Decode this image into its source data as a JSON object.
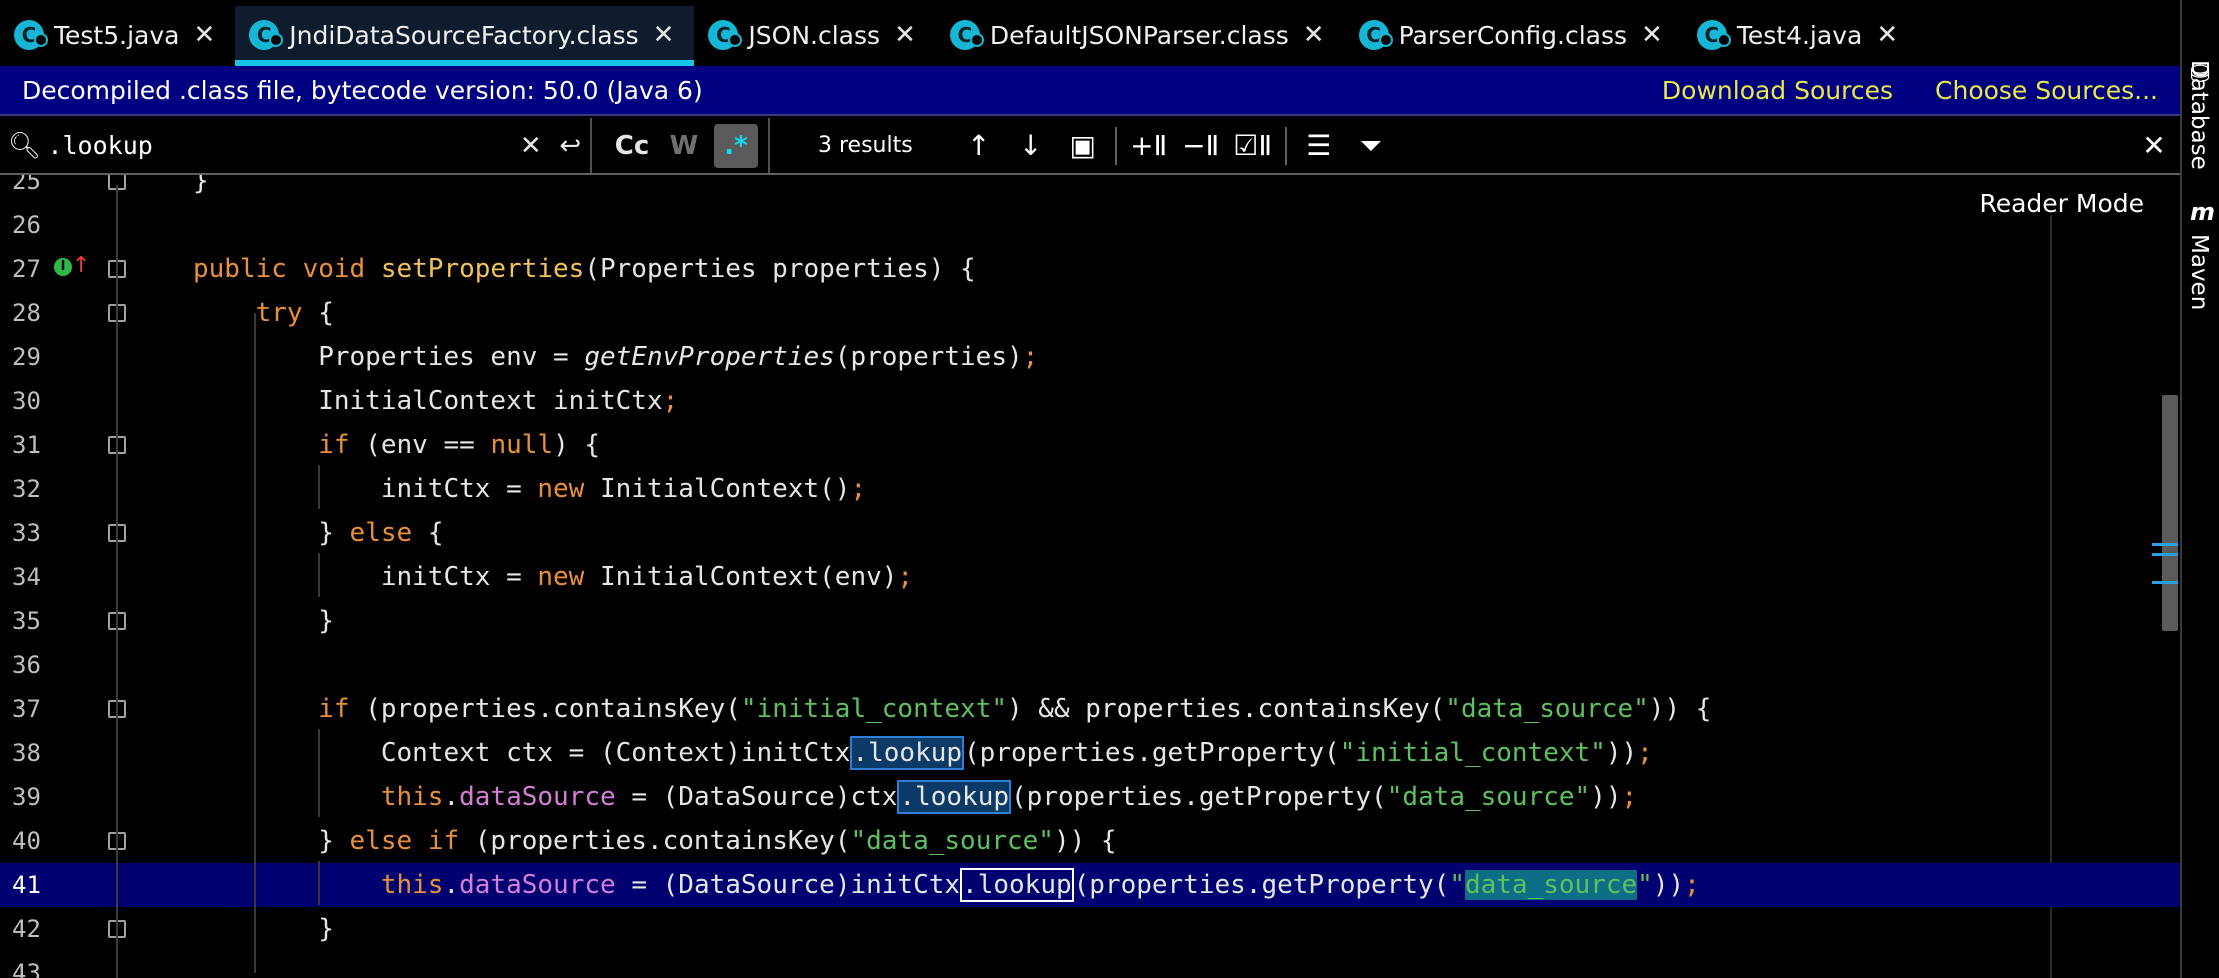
{
  "tabs": [
    {
      "label": "Test5.java",
      "active": false
    },
    {
      "label": "JndiDataSourceFactory.class",
      "active": true
    },
    {
      "label": "JSON.class",
      "active": false
    },
    {
      "label": "DefaultJSONParser.class",
      "active": false
    },
    {
      "label": "ParserConfig.class",
      "active": false
    },
    {
      "label": "Test4.java",
      "active": false
    }
  ],
  "banner": {
    "message": "Decompiled .class file, bytecode version: 50.0 (Java 6)",
    "download_sources": "Download Sources",
    "choose_sources": "Choose Sources..."
  },
  "find": {
    "query": ".lookup",
    "match_case": "Cc",
    "words": "W",
    "regex": ".*",
    "results": "3 results"
  },
  "editor": {
    "reader_mode": "Reader Mode",
    "line_numbers": [
      "25",
      "26",
      "27",
      "28",
      "29",
      "30",
      "31",
      "32",
      "33",
      "34",
      "35",
      "36",
      "37",
      "38",
      "39",
      "40",
      "41",
      "42",
      "43"
    ],
    "caret_line": "41"
  },
  "right_strip": {
    "database": "Database",
    "maven": "Maven"
  },
  "colors": {
    "banner_bg": "#000080",
    "active_tab_accent": "#18c4e6",
    "keyword": "#e8903a",
    "string": "#5ec05e",
    "method": "#f2c25a",
    "field": "#d47ed8"
  }
}
